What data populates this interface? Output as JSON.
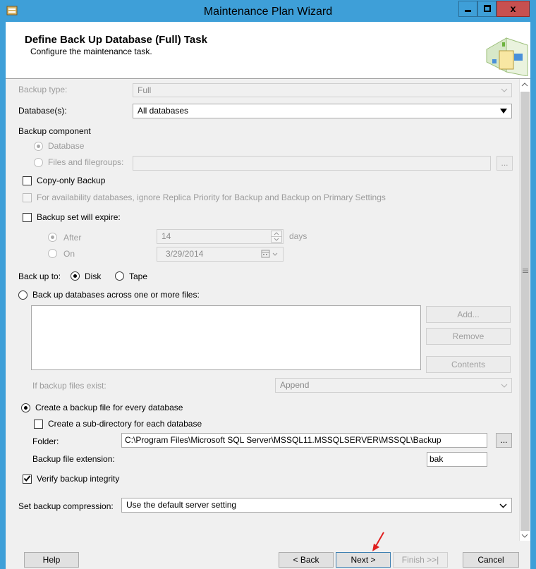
{
  "window": {
    "title": "Maintenance Plan Wizard",
    "close_glyph": "x"
  },
  "header": {
    "title": "Define Back Up Database (Full) Task",
    "subtitle": "Configure the maintenance task."
  },
  "form": {
    "backup_type_label": "Backup type:",
    "backup_type_value": "Full",
    "databases_label": "Database(s):",
    "databases_value": "All databases",
    "backup_component_label": "Backup component",
    "component_database": "Database",
    "component_files": "Files and filegroups:",
    "browse_glyph": "...",
    "copy_only": "Copy-only Backup",
    "availability": "For availability databases, ignore Replica Priority for Backup and Backup on Primary Settings",
    "expire": "Backup set will expire:",
    "after_label": "After",
    "after_value": "14",
    "days_label": "days",
    "on_label": "On",
    "on_value": "3/29/2014",
    "backup_to_label": "Back up to:",
    "disk_label": "Disk",
    "tape_label": "Tape",
    "across_files": "Back up databases across one or more files:",
    "add_button": "Add...",
    "remove_button": "Remove",
    "contents_button": "Contents",
    "if_exist_label": "If backup files exist:",
    "if_exist_value": "Append",
    "create_file": "Create a backup file for every database",
    "sub_directory": "Create a sub-directory for each database",
    "folder_label": "Folder:",
    "folder_value": "C:\\Program Files\\Microsoft SQL Server\\MSSQL11.MSSQLSERVER\\MSSQL\\Backup",
    "extension_label": "Backup file extension:",
    "extension_value": "bak",
    "verify": "Verify backup integrity",
    "compression_label": "Set backup compression:",
    "compression_value": "Use the default server setting"
  },
  "footer": {
    "help": "Help",
    "back": "< Back",
    "next": "Next >",
    "finish": "Finish >>|",
    "cancel": "Cancel"
  },
  "colors": {
    "titlebar": "#3e9fd8",
    "close": "#c75050",
    "annotation_arrow": "#e02020"
  }
}
